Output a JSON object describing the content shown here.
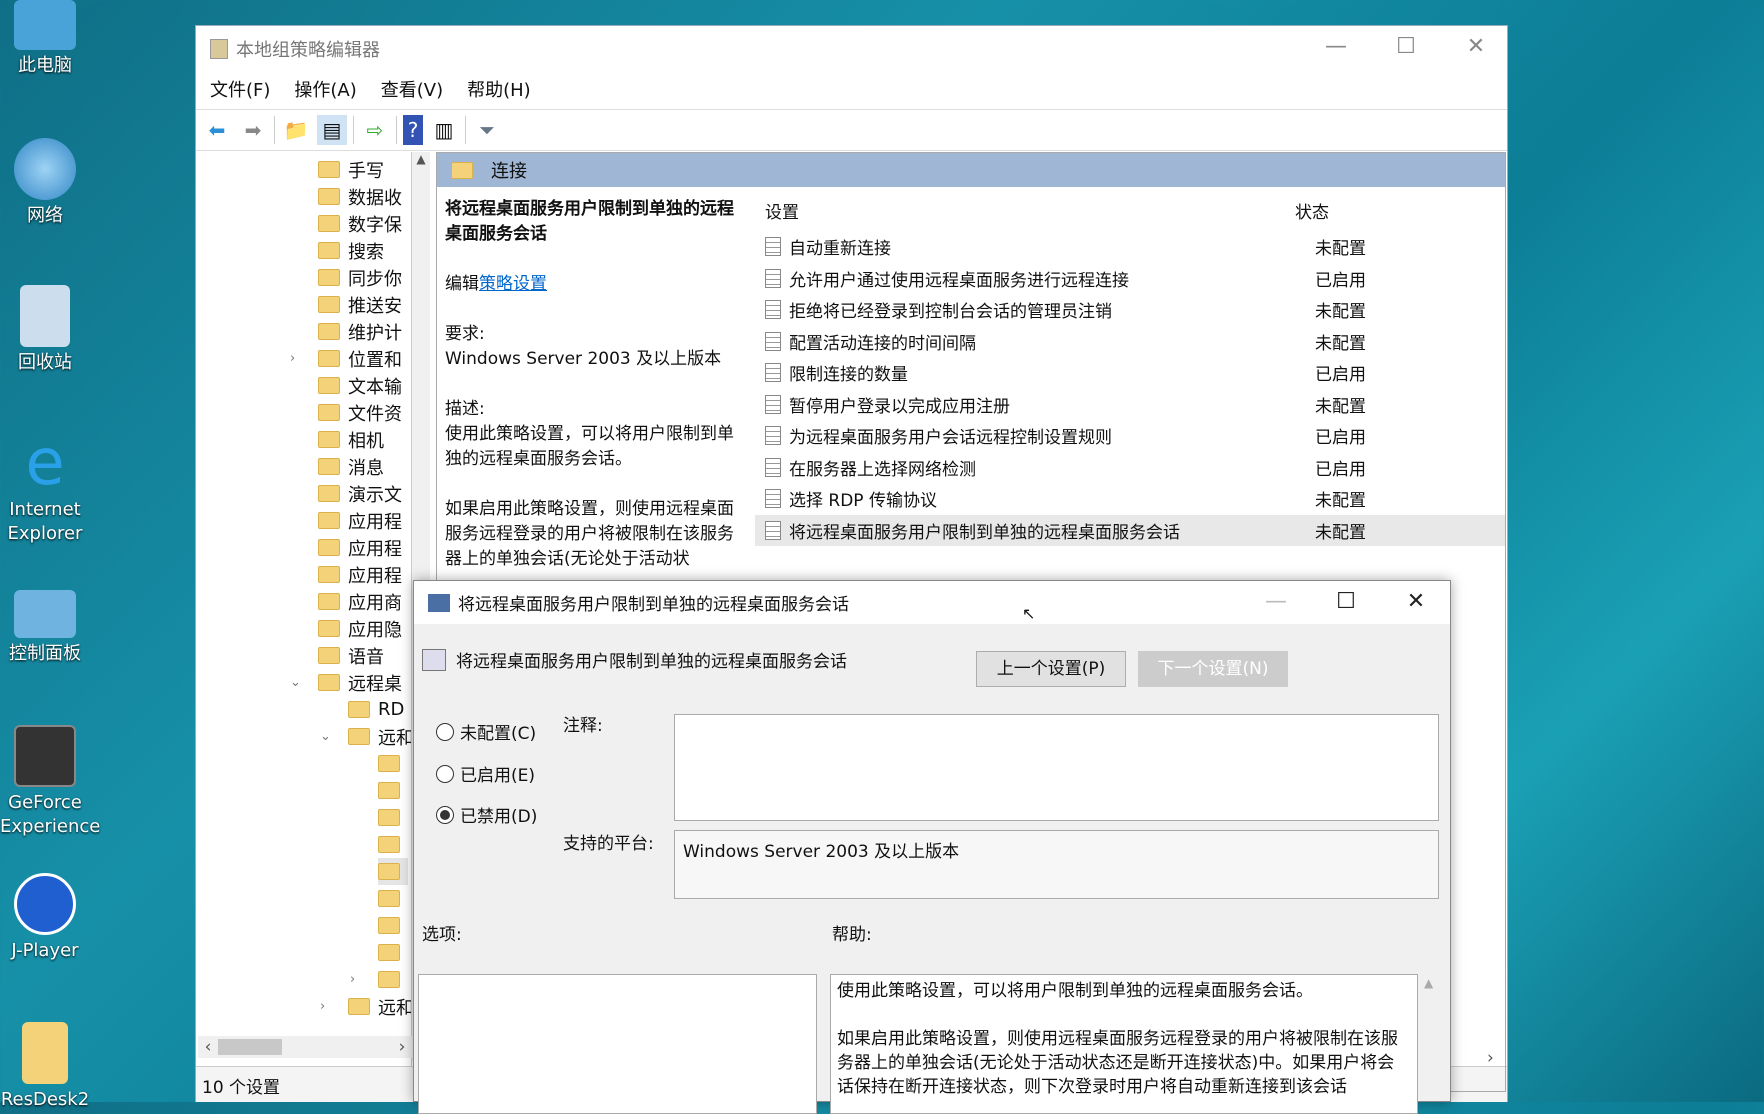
{
  "desktop": {
    "icons": [
      "此电脑",
      "网络",
      "回收站",
      "Internet Explorer",
      "控制面板",
      "GeForce Experience",
      "J-Player",
      "ResDesk2"
    ]
  },
  "window": {
    "title": "本地组策略编辑器",
    "menu": [
      "文件(F)",
      "操作(A)",
      "查看(V)",
      "帮助(H)"
    ],
    "toolbar": [
      "back-icon",
      "forward-icon",
      "up-folder-icon",
      "show-hide-tree-icon",
      "export-list-icon",
      "help-icon",
      "show-action-pane-icon",
      "filter-icon"
    ],
    "tree": [
      "手写",
      "数据收",
      "数字保",
      "搜索",
      "同步你",
      "推送安",
      "维护计",
      "位置和",
      "文本输",
      "文件资",
      "相机",
      "消息",
      "演示文",
      "应用程",
      "应用程",
      "应用程",
      "应用商",
      "应用隐",
      "语音",
      "远程桌",
      "RD",
      "远和",
      "",
      "",
      "",
      "",
      "",
      "",
      "",
      "",
      "",
      "远和"
    ],
    "status": "10 个设置",
    "panel": {
      "folder": "连接",
      "desc": {
        "title": "将远程桌面服务用户限制到单独的远程桌面服务会话",
        "edit_prefix": "编辑",
        "edit_link": "策略设置",
        "req_label": "要求:",
        "req": "Windows Server 2003 及以上版本",
        "desc_label": "描述:",
        "desc1": "使用此策略设置，可以将用户限制到单独的远程桌面服务会话。",
        "desc2": "如果启用此策略设置，则使用远程桌面服务远程登录的用户将被限制在该服务器上的单独会话(无论处于活动状"
      },
      "columns": {
        "setting": "设置",
        "state": "状态"
      },
      "rows": [
        {
          "name": "自动重新连接",
          "state": "未配置"
        },
        {
          "name": "允许用户通过使用远程桌面服务进行远程连接",
          "state": "已启用"
        },
        {
          "name": "拒绝将已经登录到控制台会话的管理员注销",
          "state": "未配置"
        },
        {
          "name": "配置活动连接的时间间隔",
          "state": "未配置"
        },
        {
          "name": "限制连接的数量",
          "state": "已启用"
        },
        {
          "name": "暂停用户登录以完成应用注册",
          "state": "未配置"
        },
        {
          "name": "为远程桌面服务用户会话远程控制设置规则",
          "state": "已启用"
        },
        {
          "name": "在服务器上选择网络检测",
          "state": "已启用"
        },
        {
          "name": "选择 RDP 传输协议",
          "state": "未配置"
        },
        {
          "name": "将远程桌面服务用户限制到单独的远程桌面服务会话",
          "state": "未配置"
        }
      ]
    }
  },
  "dialog": {
    "title": "将远程桌面服务用户限制到单独的远程桌面服务会话",
    "heading": "将远程桌面服务用户限制到单独的远程桌面服务会话",
    "prev": "上一个设置(P)",
    "next": "下一个设置(N)",
    "radios": [
      {
        "label": "未配置(C)",
        "checked": false
      },
      {
        "label": "已启用(E)",
        "checked": false
      },
      {
        "label": "已禁用(D)",
        "checked": true
      }
    ],
    "comment_label": "注释:",
    "comment": "",
    "platform_label": "支持的平台:",
    "platform": "Windows Server 2003 及以上版本",
    "options_label": "选项:",
    "help_label": "帮助:",
    "help1": "使用此策略设置，可以将用户限制到单独的远程桌面服务会话。",
    "help2": "如果启用此策略设置，则使用远程桌面服务远程登录的用户将被限制在该服务器上的单独会话(无论处于活动状态还是断开连接状态)中。如果用户将会话保持在断开连接状态，则下次登录时用户将自动重新连接到该会话"
  }
}
